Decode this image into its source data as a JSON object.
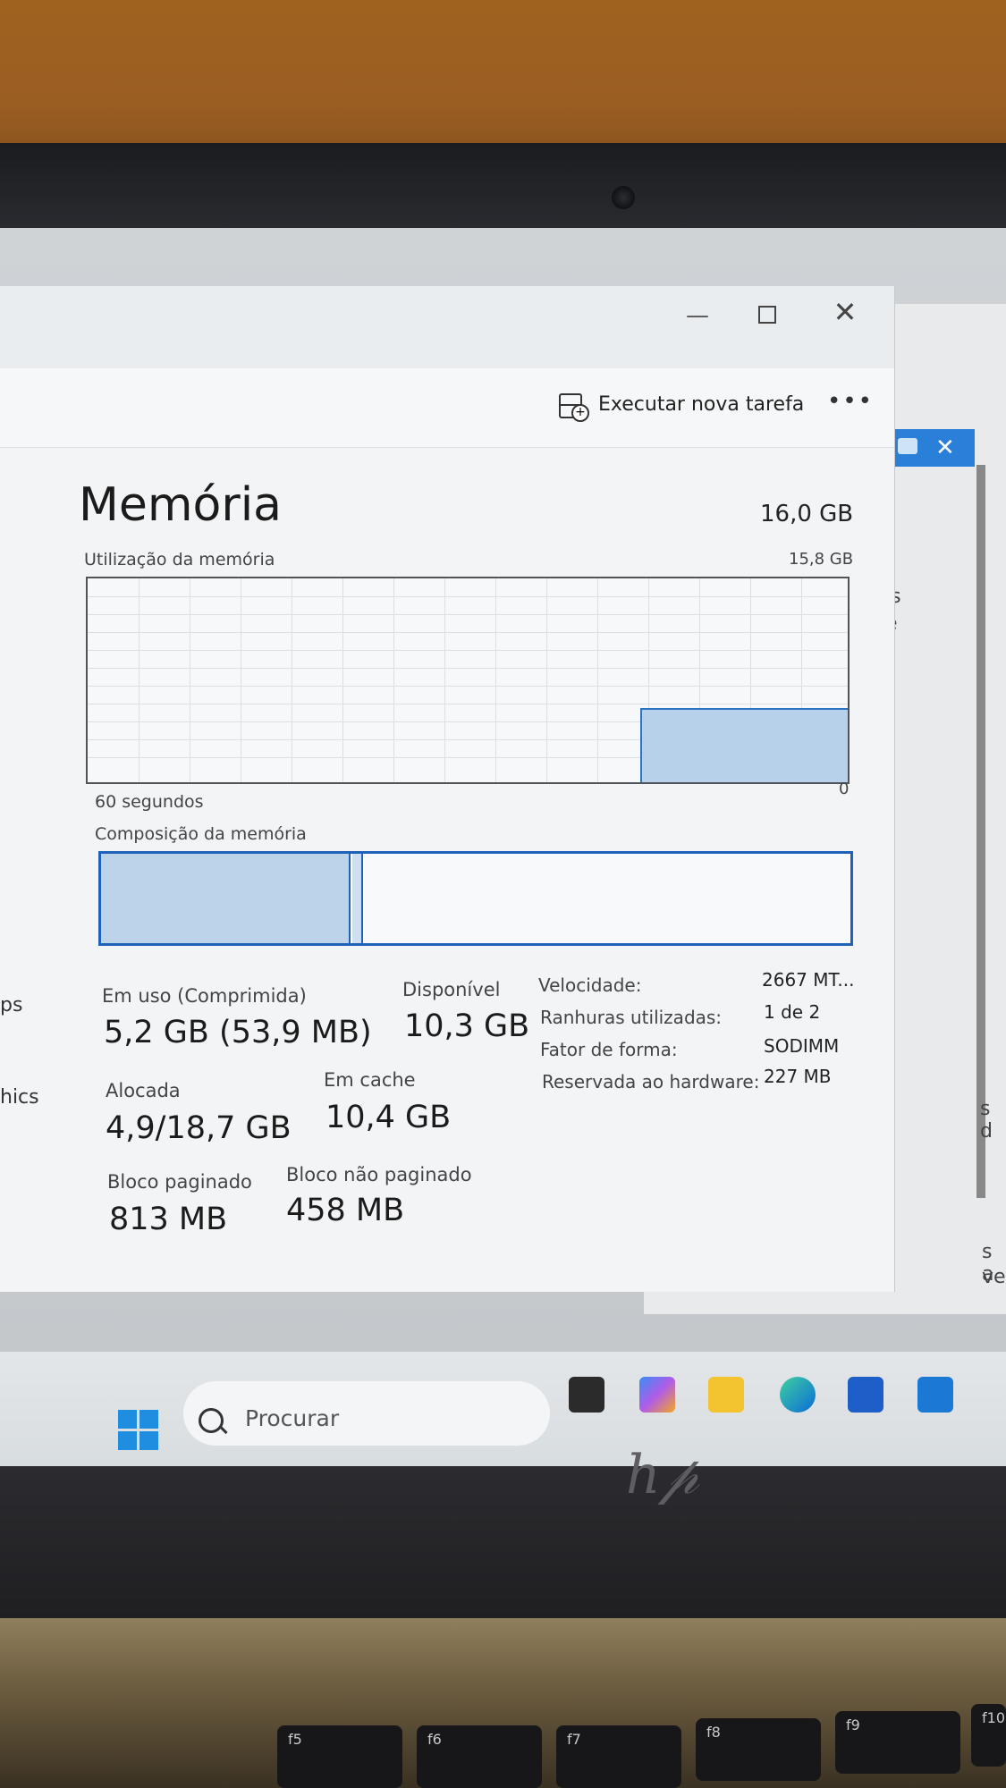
{
  "window": {
    "toolbar": {
      "new_task_label": "Executar nova tarefa",
      "more_label": "•••"
    },
    "controls": {
      "minimize": "—",
      "close": "✕"
    }
  },
  "memory": {
    "title": "Memória",
    "total": "16,0 GB",
    "usage_graph": {
      "label": "Utilização da memória",
      "max_label": "15,8 GB",
      "span_label": "60 segundos",
      "min_label": "0"
    },
    "composition_label": "Composição da memória",
    "composition": {
      "in_use_fraction": 0.33,
      "modified_fraction": 0.012
    },
    "stats": {
      "in_use": {
        "label": "Em uso (Comprimida)",
        "value": "5,2 GB (53,9 MB)"
      },
      "available": {
        "label": "Disponível",
        "value": "10,3 GB"
      },
      "committed": {
        "label": "Alocada",
        "value": "4,9/18,7 GB"
      },
      "cached": {
        "label": "Em cache",
        "value": "10,4 GB"
      },
      "paged_pool": {
        "label": "Bloco paginado",
        "value": "813 MB"
      },
      "nonpaged_pool": {
        "label": "Bloco não paginado",
        "value": "458 MB"
      }
    },
    "specs": [
      {
        "label": "Velocidade:",
        "value": "2667 MT..."
      },
      {
        "label": "Ranhuras utilizadas:",
        "value": "1 de 2"
      },
      {
        "label": "Fator de forma:",
        "value": "SODIMM"
      },
      {
        "label": "Reservada ao hardware:",
        "value": "227 MB"
      }
    ]
  },
  "left_fragments": [
    "ps",
    "hics"
  ],
  "right_fragments": [
    "is",
    "e",
    "s d",
    "s a",
    "ve"
  ],
  "taskbar": {
    "search_placeholder": "Procurar"
  },
  "keyboard_keys": [
    "f5",
    "f6",
    "f7",
    "f8",
    "f9",
    "f10"
  ],
  "colors": {
    "graph_fill": "#b8d1ea",
    "accent": "#1f63b8",
    "start_blue": "#1f8de0"
  },
  "icons": [
    "minimize-icon",
    "maximize-icon",
    "close-icon",
    "new-task-icon",
    "more-icon",
    "search-icon",
    "windows-start-icon",
    "copilot-icon",
    "file-explorer-icon",
    "edge-icon",
    "store-icon",
    "outlook-icon"
  ]
}
